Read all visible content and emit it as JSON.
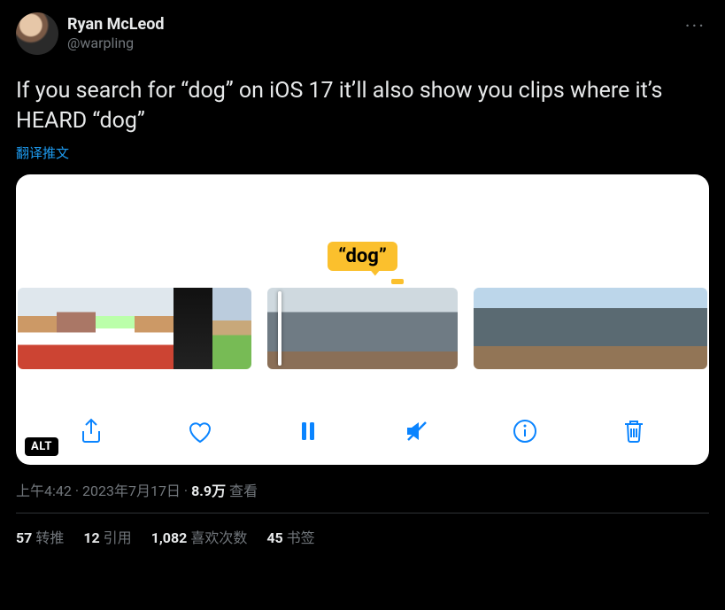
{
  "author": {
    "name": "Ryan McLeod",
    "handle": "@warpling"
  },
  "body": "If you search for “dog” on iOS 17 it’ll also show you clips where it’s HEARD “dog”",
  "translate": "翻译推文",
  "media": {
    "tooltip": "“dog”",
    "alt_badge": "ALT"
  },
  "meta": {
    "time": "上午4:42",
    "sep1": " · ",
    "date": "2023年7月17日",
    "sep2": " · ",
    "views_num": "8.9万",
    "views_label": " 查看"
  },
  "stats": {
    "retweets_num": "57",
    "retweets_label": " 转推",
    "quotes_num": "12",
    "quotes_label": " 引用",
    "likes_num": "1,082",
    "likes_label": " 喜欢次数",
    "bookmarks_num": "45",
    "bookmarks_label": " 书签"
  }
}
